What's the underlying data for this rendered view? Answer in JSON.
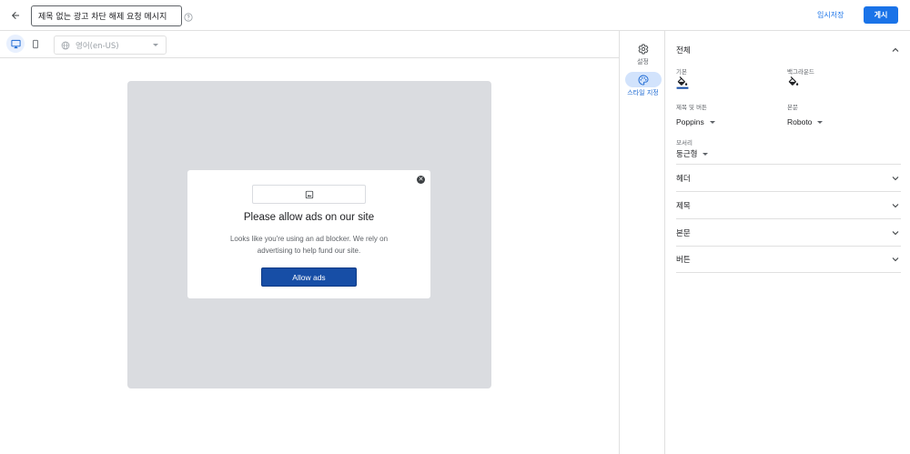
{
  "header": {
    "title_value": "제목 없는 광고 차단 해제 요청 메시지",
    "save_draft_label": "임시저장",
    "publish_label": "게시"
  },
  "preview_toolbar": {
    "language_value": "영어(en-US)"
  },
  "dialog": {
    "title": "Please allow ads on our site",
    "body": "Looks like you're using an ad blocker. We rely on advertising to help fund our site.",
    "button_label": "Allow ads",
    "close_glyph": "✕"
  },
  "rail": {
    "items": [
      {
        "label": "설정",
        "icon": "gear-icon"
      },
      {
        "label": "스타일 지정",
        "icon": "palette-icon"
      }
    ]
  },
  "panel": {
    "sections": [
      {
        "name": "전체",
        "expanded": true
      },
      {
        "name": "헤더",
        "expanded": false
      },
      {
        "name": "제목",
        "expanded": false
      },
      {
        "name": "본문",
        "expanded": false
      },
      {
        "name": "버튼",
        "expanded": false
      }
    ],
    "overall": {
      "default_color_label": "기본",
      "background_color_label": "백그라운드",
      "heading_font_label": "제목 및 버튼",
      "heading_font_value": "Poppins",
      "body_font_label": "본문",
      "body_font_value": "Roboto",
      "corner_label": "모서리",
      "corner_value": "둥근형"
    }
  },
  "colors": {
    "accent": "#1a73e8",
    "button": "#174ea6",
    "canvas": "#dadce0",
    "rail_active": "#d2e3fc"
  }
}
